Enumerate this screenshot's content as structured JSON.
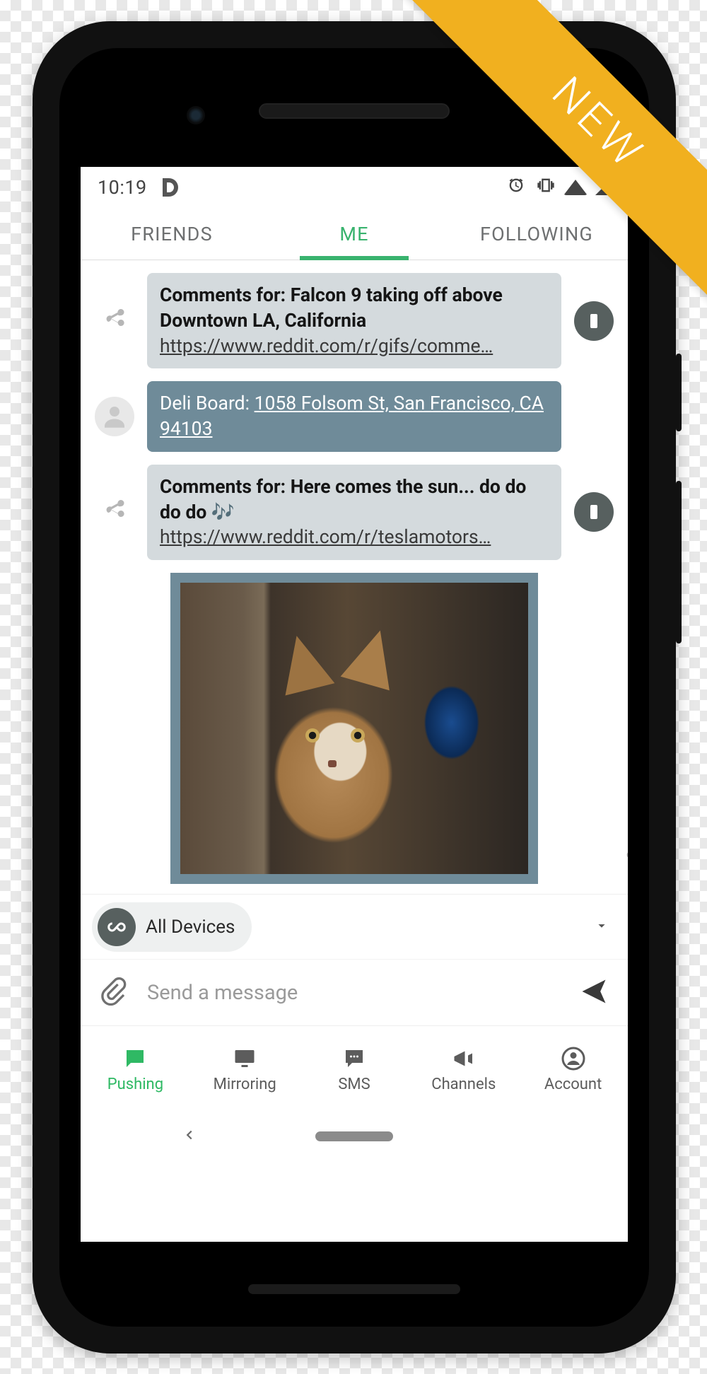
{
  "ribbon": {
    "label": "NEW"
  },
  "statusbar": {
    "time": "10:19"
  },
  "toptabs": {
    "items": [
      {
        "label": "FRIENDS",
        "active": false
      },
      {
        "label": "ME",
        "active": true
      },
      {
        "label": "FOLLOWING",
        "active": false
      }
    ]
  },
  "messages": {
    "m0": {
      "title": "Comments for: Falcon 9 taking off above Downtown LA, California",
      "link": "https://www.reddit.com/r/gifs/comme…"
    },
    "m1": {
      "prefix": "Deli Board: ",
      "address": "1058 Folsom St, San Francisco, CA 94103"
    },
    "m2": {
      "title": "Comments for: Here comes the sun... do do do do 🎶",
      "link": "https://www.reddit.com/r/teslamotors…"
    }
  },
  "device_selector": {
    "selected": "All Devices"
  },
  "compose": {
    "placeholder": "Send a message"
  },
  "bottomnav": {
    "items": [
      {
        "label": "Pushing"
      },
      {
        "label": "Mirroring"
      },
      {
        "label": "SMS"
      },
      {
        "label": "Channels"
      },
      {
        "label": "Account"
      }
    ]
  }
}
